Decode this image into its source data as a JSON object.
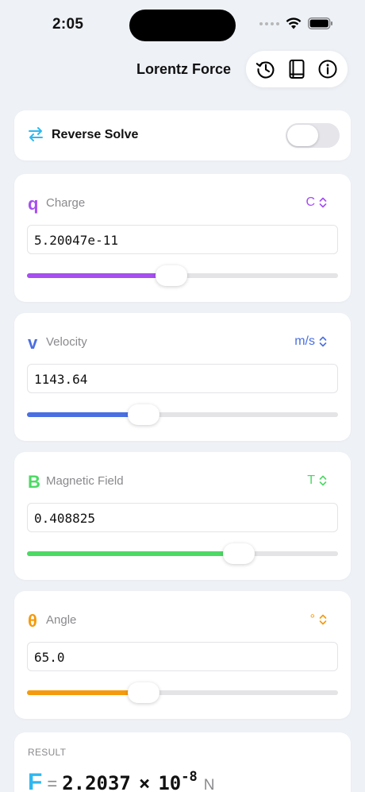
{
  "status_bar": {
    "time": "2:05"
  },
  "nav": {
    "title": "Lorentz Force",
    "icons": [
      "history-icon",
      "book-icon",
      "info-icon"
    ]
  },
  "reverse_solve": {
    "label": "Reverse Solve",
    "enabled": false
  },
  "variables": [
    {
      "symbol": "q",
      "label": "Charge",
      "unit": "C",
      "value": "5.20047e-11",
      "slider_fraction": 0.465,
      "color": "#a64ef0"
    },
    {
      "symbol": "v",
      "label": "Velocity",
      "unit": "m/s",
      "value": "1143.64",
      "slider_fraction": 0.375,
      "color": "#4a6fe3"
    },
    {
      "symbol": "B",
      "label": "Magnetic Field",
      "unit": "T",
      "value": "0.408825",
      "slider_fraction": 0.68,
      "color": "#4cd964"
    },
    {
      "symbol": "θ",
      "label": "Angle",
      "unit": "°",
      "value": "65.0",
      "slider_fraction": 0.375,
      "color": "#f59a0c"
    }
  ],
  "result": {
    "label": "RESULT",
    "symbol": "F",
    "equals": "=",
    "mantissa": "2.2037",
    "times": "×",
    "base": "10",
    "exponent": "-8",
    "unit": "N",
    "symbol_color": "#2fb8f0"
  },
  "colors": {
    "background": "#eef1f6",
    "reverse_icon": "#2fb8f0"
  }
}
